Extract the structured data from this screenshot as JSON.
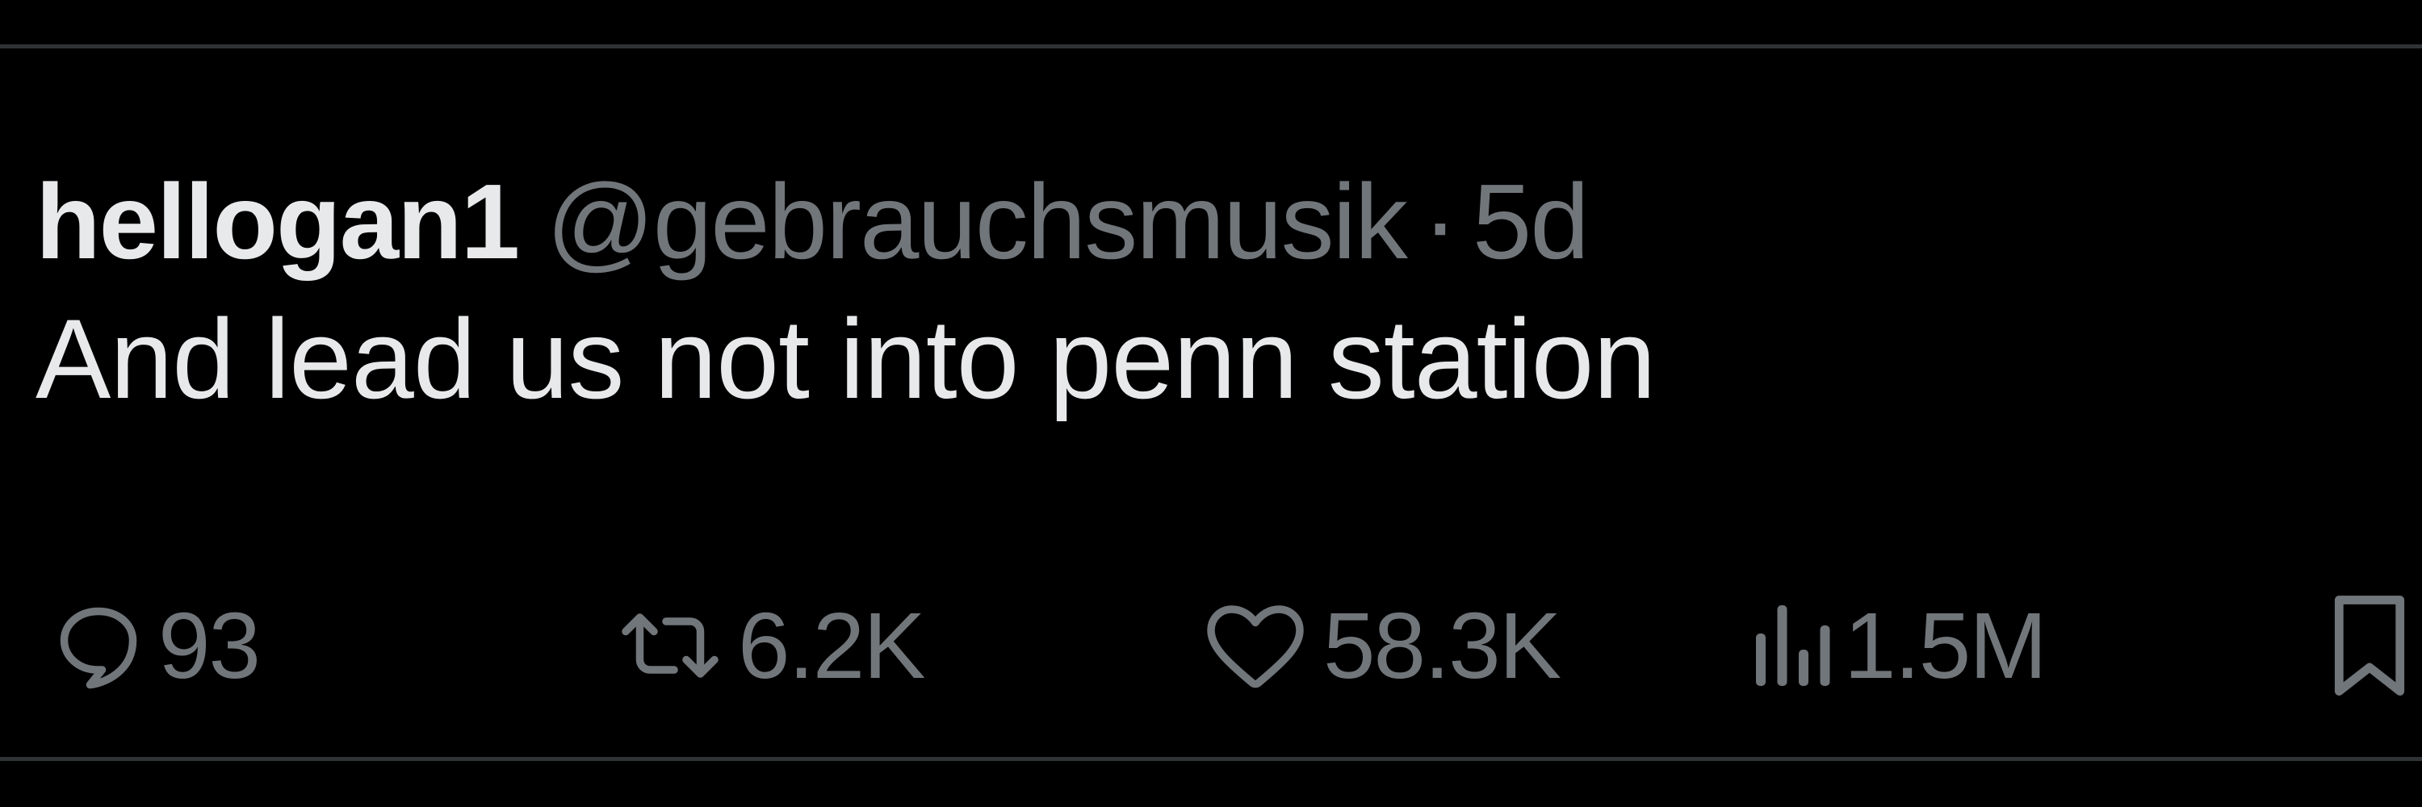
{
  "tweet": {
    "display_name": "hellogan1",
    "handle": "@gebrauchsmusik",
    "separator": "·",
    "timestamp": "5d",
    "text": "And lead us not into penn station"
  },
  "actions": {
    "replies": "93",
    "retweets": "6.2K",
    "likes": "58.3K",
    "views": "1.5M"
  },
  "icons": {
    "reply": "reply-icon",
    "retweet": "retweet-icon",
    "like": "heart-icon",
    "views": "views-icon",
    "bookmark": "bookmark-icon"
  },
  "colors": {
    "background": "#000000",
    "primary_text": "#e7e9ea",
    "secondary_text": "#71767b",
    "divider": "#2f3336"
  }
}
